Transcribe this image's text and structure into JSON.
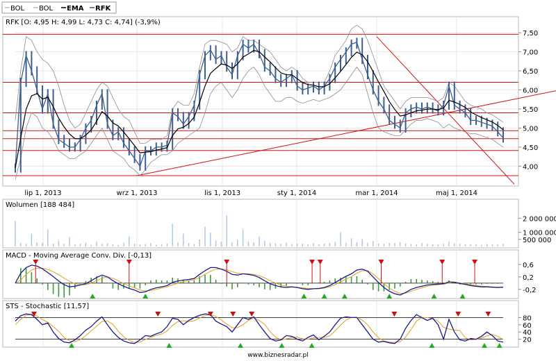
{
  "legend": [
    {
      "label": "BOL",
      "color": "#9a9a9a",
      "bold": false
    },
    {
      "label": "BOL",
      "color": "#9a9a9a",
      "bold": false
    },
    {
      "label": "EMA",
      "color": "#000000",
      "bold": true
    },
    {
      "label": "RFK",
      "color": "#3a5a8a",
      "bold": true
    }
  ],
  "watermark": "www.biznesradar.pl",
  "colors": {
    "price": "#3d5f8f",
    "bollinger": "#8c8c8c",
    "ema": "#000000",
    "support": "#d01010",
    "volume": "#a9c3e0",
    "indicator": "#1a1a8a",
    "signal": "#e0a020",
    "histogram": "#3a9a3a",
    "sell_marker": "#d01010",
    "buy_marker": "#22aa22",
    "frame": "#b8b8b8",
    "grid": "#e6e6e6"
  },
  "chart_data": [
    {
      "type": "candlestick",
      "title": "RFK [O: 4,95  H: 4,99  L: 4,73  C: 4,74] (-3,9%)",
      "xlabel": "",
      "ylabel": "",
      "x_ticks": [
        "lip 1, 2013",
        "wrz 1, 2013",
        "lis 1, 2013",
        "sty 1, 2014",
        "mar 1, 2014",
        "maj 1, 2014"
      ],
      "y_ticks": [
        "7,50",
        "7,00",
        "6,50",
        "6,00",
        "5,50",
        "5,00",
        "4,50",
        "4,00"
      ],
      "ylim": [
        3.55,
        7.85
      ],
      "ohlc_last": {
        "open": 4.95,
        "high": 4.99,
        "low": 4.73,
        "close": 4.74,
        "change_pct": -3.9
      },
      "horizontal_levels": [
        7.46,
        6.2,
        5.4,
        4.93,
        4.72,
        4.41,
        3.75
      ],
      "trendlines": [
        {
          "from": [
            "wrz 1, 2013",
            3.75
          ],
          "to": [
            "maj 1, 2014",
            5.45
          ]
        },
        {
          "from": [
            "mar 1, 2014",
            7.4
          ],
          "to": [
            "maj 1, 2014",
            5.15
          ]
        }
      ],
      "series_close": [
        3.95,
        6.2,
        6.9,
        6.5,
        6.0,
        5.5,
        5.9,
        5.1,
        4.7,
        4.6,
        4.5,
        4.5,
        4.7,
        5.0,
        5.2,
        5.6,
        5.9,
        5.1,
        4.8,
        4.9,
        4.6,
        4.4,
        4.2,
        4.0,
        4.4,
        4.4,
        4.5,
        4.5,
        4.55,
        5.4,
        5.3,
        5.1,
        5.3,
        5.6,
        6.4,
        6.9,
        7.05,
        6.8,
        6.9,
        6.6,
        6.4,
        6.9,
        7.2,
        7.1,
        7.2,
        6.95,
        6.6,
        6.5,
        6.3,
        6.2,
        6.3,
        6.4,
        6.1,
        6.0,
        6.05,
        6.1,
        6.0,
        6.1,
        6.3,
        6.6,
        6.8,
        7.0,
        7.2,
        7.25,
        6.8,
        6.4,
        6.0,
        5.7,
        5.5,
        5.2,
        5.1,
        5.0,
        5.4,
        5.5,
        5.55,
        5.5,
        5.55,
        5.5,
        5.45,
        5.6,
        6.1,
        5.6,
        5.5,
        5.4,
        5.2,
        5.2,
        5.15,
        5.1,
        5.05,
        4.9,
        4.74
      ],
      "bollinger_upper": [
        5.2,
        6.5,
        7.4,
        7.3,
        7.0,
        6.8,
        6.7,
        6.5,
        6.1,
        5.6,
        5.2,
        5.0,
        5.1,
        5.4,
        5.7,
        6.0,
        6.2,
        6.1,
        5.8,
        5.5,
        5.3,
        5.2,
        4.9,
        4.6,
        4.6,
        4.7,
        4.7,
        4.7,
        4.8,
        5.5,
        5.7,
        5.6,
        5.6,
        5.9,
        6.6,
        7.2,
        7.3,
        7.3,
        7.25,
        7.2,
        7.0,
        7.1,
        7.4,
        7.3,
        7.3,
        7.2,
        7.1,
        7.0,
        6.8,
        6.6,
        6.5,
        6.6,
        6.5,
        6.3,
        6.2,
        6.2,
        6.2,
        6.2,
        6.5,
        6.9,
        7.1,
        7.3,
        7.6,
        7.7,
        7.6,
        7.3,
        6.9,
        6.5,
        6.1,
        5.9,
        5.7,
        5.5,
        5.7,
        5.8,
        5.8,
        5.8,
        5.8,
        5.75,
        5.7,
        5.8,
        6.2,
        6.1,
        5.9,
        5.7,
        5.6,
        5.55,
        5.5,
        5.4,
        5.35,
        5.25,
        5.15
      ],
      "bollinger_lower": [
        3.65,
        4.2,
        5.0,
        5.4,
        5.3,
        5.0,
        4.9,
        4.7,
        4.4,
        4.3,
        4.2,
        4.2,
        4.3,
        4.4,
        4.6,
        4.8,
        5.0,
        4.7,
        4.4,
        4.3,
        4.2,
        4.0,
        3.9,
        3.75,
        3.9,
        4.1,
        4.2,
        4.3,
        4.3,
        4.4,
        4.6,
        4.7,
        4.8,
        4.9,
        5.0,
        5.4,
        5.9,
        6.1,
        6.2,
        6.0,
        5.8,
        6.0,
        6.3,
        6.5,
        6.6,
        6.4,
        6.1,
        5.9,
        5.7,
        5.7,
        5.8,
        5.8,
        5.7,
        5.65,
        5.7,
        5.75,
        5.7,
        5.75,
        5.8,
        5.9,
        6.0,
        6.2,
        6.4,
        6.6,
        6.4,
        5.9,
        5.4,
        5.0,
        4.9,
        4.85,
        4.8,
        4.8,
        4.95,
        5.1,
        5.2,
        5.2,
        5.25,
        5.2,
        5.15,
        5.0,
        5.1,
        5.0,
        4.95,
        4.9,
        4.85,
        4.85,
        4.8,
        4.75,
        4.7,
        4.6,
        4.5
      ]
    },
    {
      "type": "bar",
      "title": "Wolumen [188 484]",
      "y_ticks": [
        "2 000 000",
        "1 000 000",
        "500 000"
      ],
      "ylim": [
        0,
        2700000
      ],
      "series_volume": [
        1800000,
        250000,
        180000,
        900000,
        300000,
        260000,
        1200000,
        200000,
        420000,
        180000,
        650000,
        150000,
        200000,
        260000,
        120000,
        330000,
        180000,
        220000,
        150000,
        110000,
        260000,
        700000,
        200000,
        140000,
        170000,
        240000,
        120000,
        160000,
        190000,
        1600000,
        280000,
        900000,
        240000,
        160000,
        500000,
        1400000,
        980000,
        420000,
        340000,
        2200000,
        300000,
        480000,
        1200000,
        360000,
        300000,
        700000,
        400000,
        250000,
        220000,
        180000,
        260000,
        170000,
        200000,
        190000,
        140000,
        230000,
        160000,
        190000,
        240000,
        320000,
        1000000,
        260000,
        580000,
        300000,
        520000,
        260000,
        380000,
        210000,
        190000,
        260000,
        240000,
        310000,
        200000,
        170000,
        150000,
        240000,
        180000,
        160000,
        140000,
        200000,
        330000,
        210000,
        180000,
        150000,
        140000,
        160000,
        120000,
        170000,
        150000,
        140000,
        190000
      ]
    },
    {
      "type": "line",
      "title": "MACD - Moving Average Conv. Div. [-0,13]",
      "y_ticks": [
        "0,6",
        "0,2",
        "-0,2"
      ],
      "ylim": [
        -0.45,
        0.8
      ],
      "series_macd": [
        0.0,
        0.32,
        0.5,
        0.58,
        0.55,
        0.46,
        0.34,
        0.21,
        0.07,
        -0.05,
        -0.12,
        -0.1,
        -0.06,
        -0.02,
        0.08,
        0.18,
        0.26,
        0.2,
        0.08,
        -0.02,
        -0.1,
        -0.17,
        -0.22,
        -0.3,
        -0.28,
        -0.2,
        -0.15,
        -0.12,
        -0.08,
        0.02,
        0.07,
        0.1,
        0.12,
        0.15,
        0.28,
        0.4,
        0.5,
        0.5,
        0.45,
        0.38,
        0.28,
        0.26,
        0.3,
        0.28,
        0.25,
        0.18,
        0.08,
        -0.02,
        -0.08,
        -0.12,
        -0.14,
        -0.12,
        -0.14,
        -0.18,
        -0.2,
        -0.18,
        -0.17,
        -0.14,
        -0.08,
        0.02,
        0.12,
        0.22,
        0.3,
        0.42,
        0.45,
        0.38,
        0.2,
        0.02,
        -0.14,
        -0.26,
        -0.34,
        -0.38,
        -0.3,
        -0.2,
        -0.14,
        -0.1,
        -0.06,
        -0.04,
        -0.03,
        -0.02,
        0.04,
        0.03,
        -0.01,
        -0.04,
        -0.08,
        -0.1,
        -0.12,
        -0.12,
        -0.13,
        -0.14,
        -0.13
      ],
      "series_signal": [
        0.0,
        0.1,
        0.28,
        0.42,
        0.48,
        0.48,
        0.44,
        0.37,
        0.27,
        0.16,
        0.06,
        -0.02,
        -0.05,
        -0.05,
        0.0,
        0.08,
        0.16,
        0.2,
        0.16,
        0.08,
        -0.02,
        -0.09,
        -0.15,
        -0.22,
        -0.25,
        -0.24,
        -0.2,
        -0.16,
        -0.12,
        -0.06,
        0.0,
        0.05,
        0.08,
        0.11,
        0.18,
        0.28,
        0.38,
        0.45,
        0.46,
        0.43,
        0.37,
        0.32,
        0.3,
        0.3,
        0.28,
        0.24,
        0.17,
        0.08,
        0.0,
        -0.06,
        -0.1,
        -0.12,
        -0.13,
        -0.15,
        -0.17,
        -0.18,
        -0.18,
        -0.16,
        -0.12,
        -0.05,
        0.04,
        0.13,
        0.21,
        0.32,
        0.4,
        0.4,
        0.3,
        0.14,
        -0.02,
        -0.16,
        -0.26,
        -0.33,
        -0.32,
        -0.26,
        -0.2,
        -0.15,
        -0.1,
        -0.07,
        -0.05,
        -0.03,
        0.0,
        0.02,
        0.01,
        -0.02,
        -0.05,
        -0.08,
        -0.1,
        -0.11,
        -0.12,
        -0.13,
        -0.13
      ],
      "sell_signals": [
        5,
        28,
        52,
        73,
        75,
        90,
        105,
        113
      ],
      "buy_signals": [
        19,
        32,
        71,
        76,
        81,
        92,
        103,
        110
      ]
    },
    {
      "type": "line",
      "title": "STS - Stochastic [11,57]",
      "y_ticks": [
        "80",
        "60",
        "40",
        "20"
      ],
      "ylim": [
        0,
        100
      ],
      "series_k": [
        70,
        85,
        90,
        88,
        75,
        60,
        65,
        40,
        22,
        12,
        10,
        18,
        30,
        45,
        55,
        70,
        82,
        60,
        40,
        25,
        15,
        10,
        8,
        18,
        30,
        28,
        35,
        40,
        55,
        78,
        75,
        60,
        72,
        80,
        86,
        90,
        88,
        70,
        62,
        55,
        40,
        60,
        80,
        75,
        82,
        60,
        40,
        22,
        15,
        18,
        30,
        28,
        20,
        15,
        25,
        32,
        18,
        28,
        40,
        60,
        78,
        82,
        80,
        80,
        60,
        40,
        20,
        12,
        14,
        10,
        8,
        20,
        50,
        72,
        88,
        80,
        72,
        78,
        60,
        20,
        75,
        40,
        18,
        15,
        22,
        20,
        28,
        40,
        30,
        15,
        12
      ],
      "series_d": [
        60,
        75,
        86,
        89,
        84,
        74,
        67,
        55,
        42,
        25,
        15,
        13,
        19,
        30,
        43,
        56,
        69,
        71,
        61,
        42,
        27,
        17,
        11,
        12,
        19,
        25,
        31,
        34,
        43,
        58,
        69,
        71,
        69,
        71,
        79,
        85,
        88,
        83,
        73,
        62,
        52,
        52,
        60,
        72,
        79,
        72,
        61,
        41,
        26,
        18,
        21,
        25,
        26,
        21,
        20,
        24,
        25,
        25,
        29,
        43,
        59,
        73,
        80,
        81,
        73,
        60,
        40,
        24,
        15,
        12,
        11,
        13,
        26,
        47,
        70,
        80,
        80,
        77,
        70,
        53,
        48,
        45,
        44,
        24,
        18,
        19,
        23,
        29,
        33,
        28,
        19
      ],
      "sell_signals": [
        5,
        38,
        52,
        58,
        63,
        101,
        118,
        126
      ],
      "buy_signals": [
        15,
        41,
        60,
        71,
        79,
        111,
        125,
        129
      ]
    }
  ]
}
